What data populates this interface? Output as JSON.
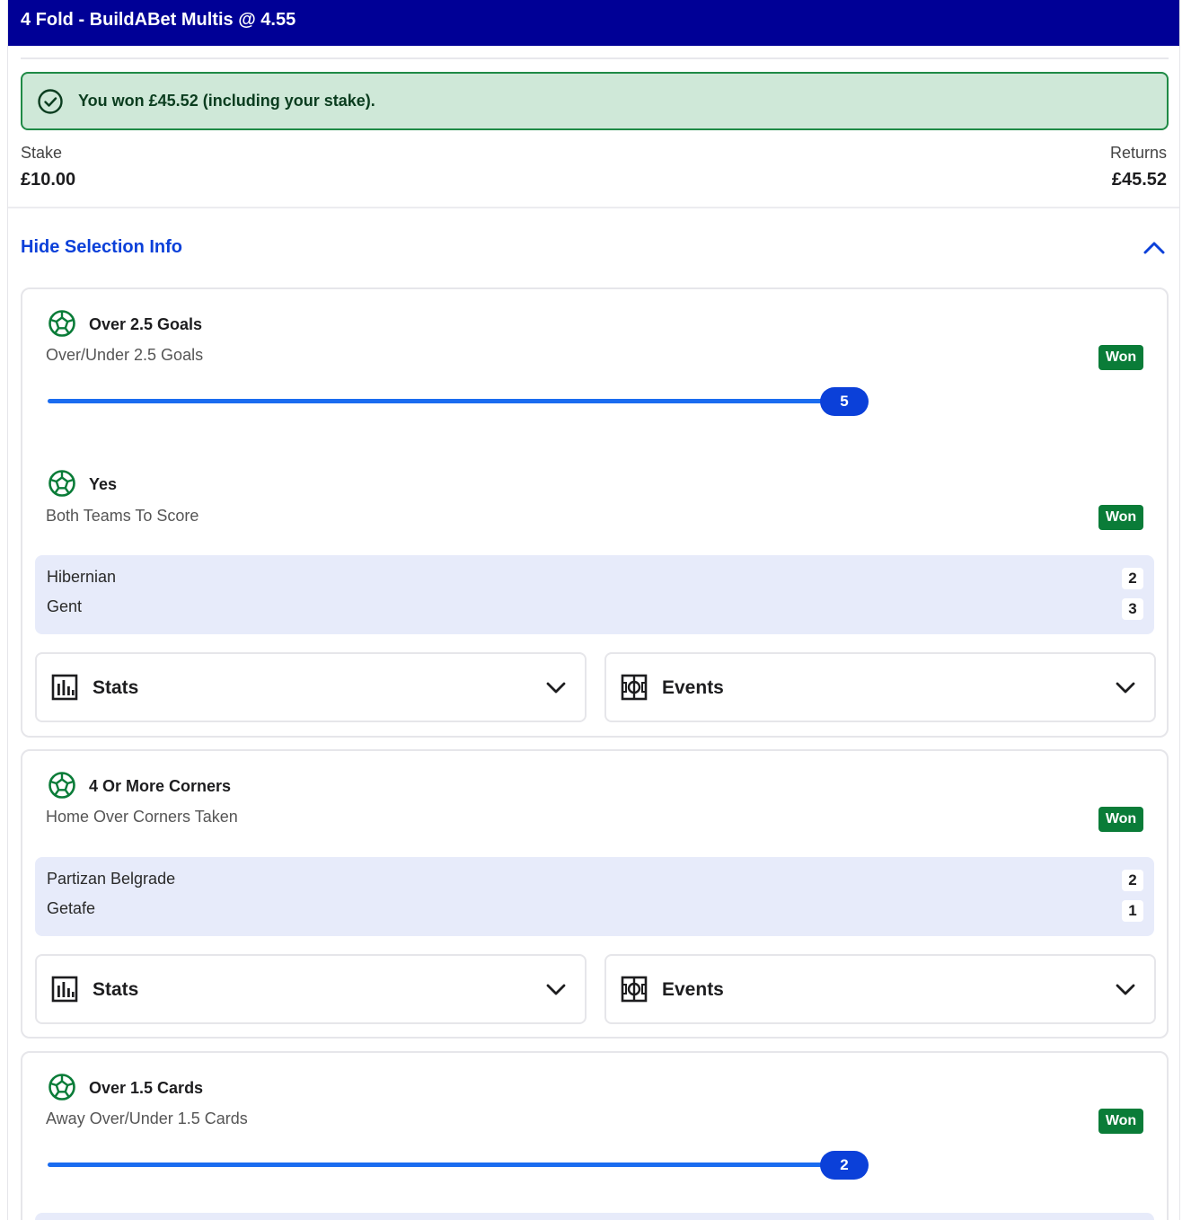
{
  "header": {
    "title": "4 Fold - BuildABet Multis @ 4.55"
  },
  "result_banner": {
    "message": "You won £45.52 (including your stake)."
  },
  "stake": {
    "label": "Stake",
    "value": "£10.00"
  },
  "returns": {
    "label": "Returns",
    "value": "£45.52"
  },
  "toggle_label": "Hide Selection Info",
  "colors": {
    "header_bg": "#000096",
    "won_green": "#0a7c38",
    "accent_blue": "#0b40d9",
    "banner_bg": "#cfe8d8"
  },
  "cards": [
    {
      "selections": [
        {
          "title": "Over 2.5 Goals",
          "market": "Over/Under 2.5 Goals",
          "status": "Won",
          "progress_value": "5",
          "progress_fraction": 1.0
        },
        {
          "title": "Yes",
          "market": "Both Teams To Score",
          "status": "Won"
        }
      ],
      "score": {
        "home": "Hibernian",
        "home_score": "2",
        "away": "Gent",
        "away_score": "3"
      },
      "dropdowns": {
        "stats": "Stats",
        "events": "Events"
      }
    },
    {
      "selections": [
        {
          "title": "4 Or More Corners",
          "market": "Home Over Corners Taken",
          "status": "Won"
        }
      ],
      "score": {
        "home": "Partizan Belgrade",
        "home_score": "2",
        "away": "Getafe",
        "away_score": "1"
      },
      "dropdowns": {
        "stats": "Stats",
        "events": "Events"
      }
    },
    {
      "selections": [
        {
          "title": "Over 1.5 Cards",
          "market": "Away Over/Under 1.5 Cards",
          "status": "Won",
          "progress_value": "2",
          "progress_fraction": 1.0
        }
      ]
    }
  ]
}
